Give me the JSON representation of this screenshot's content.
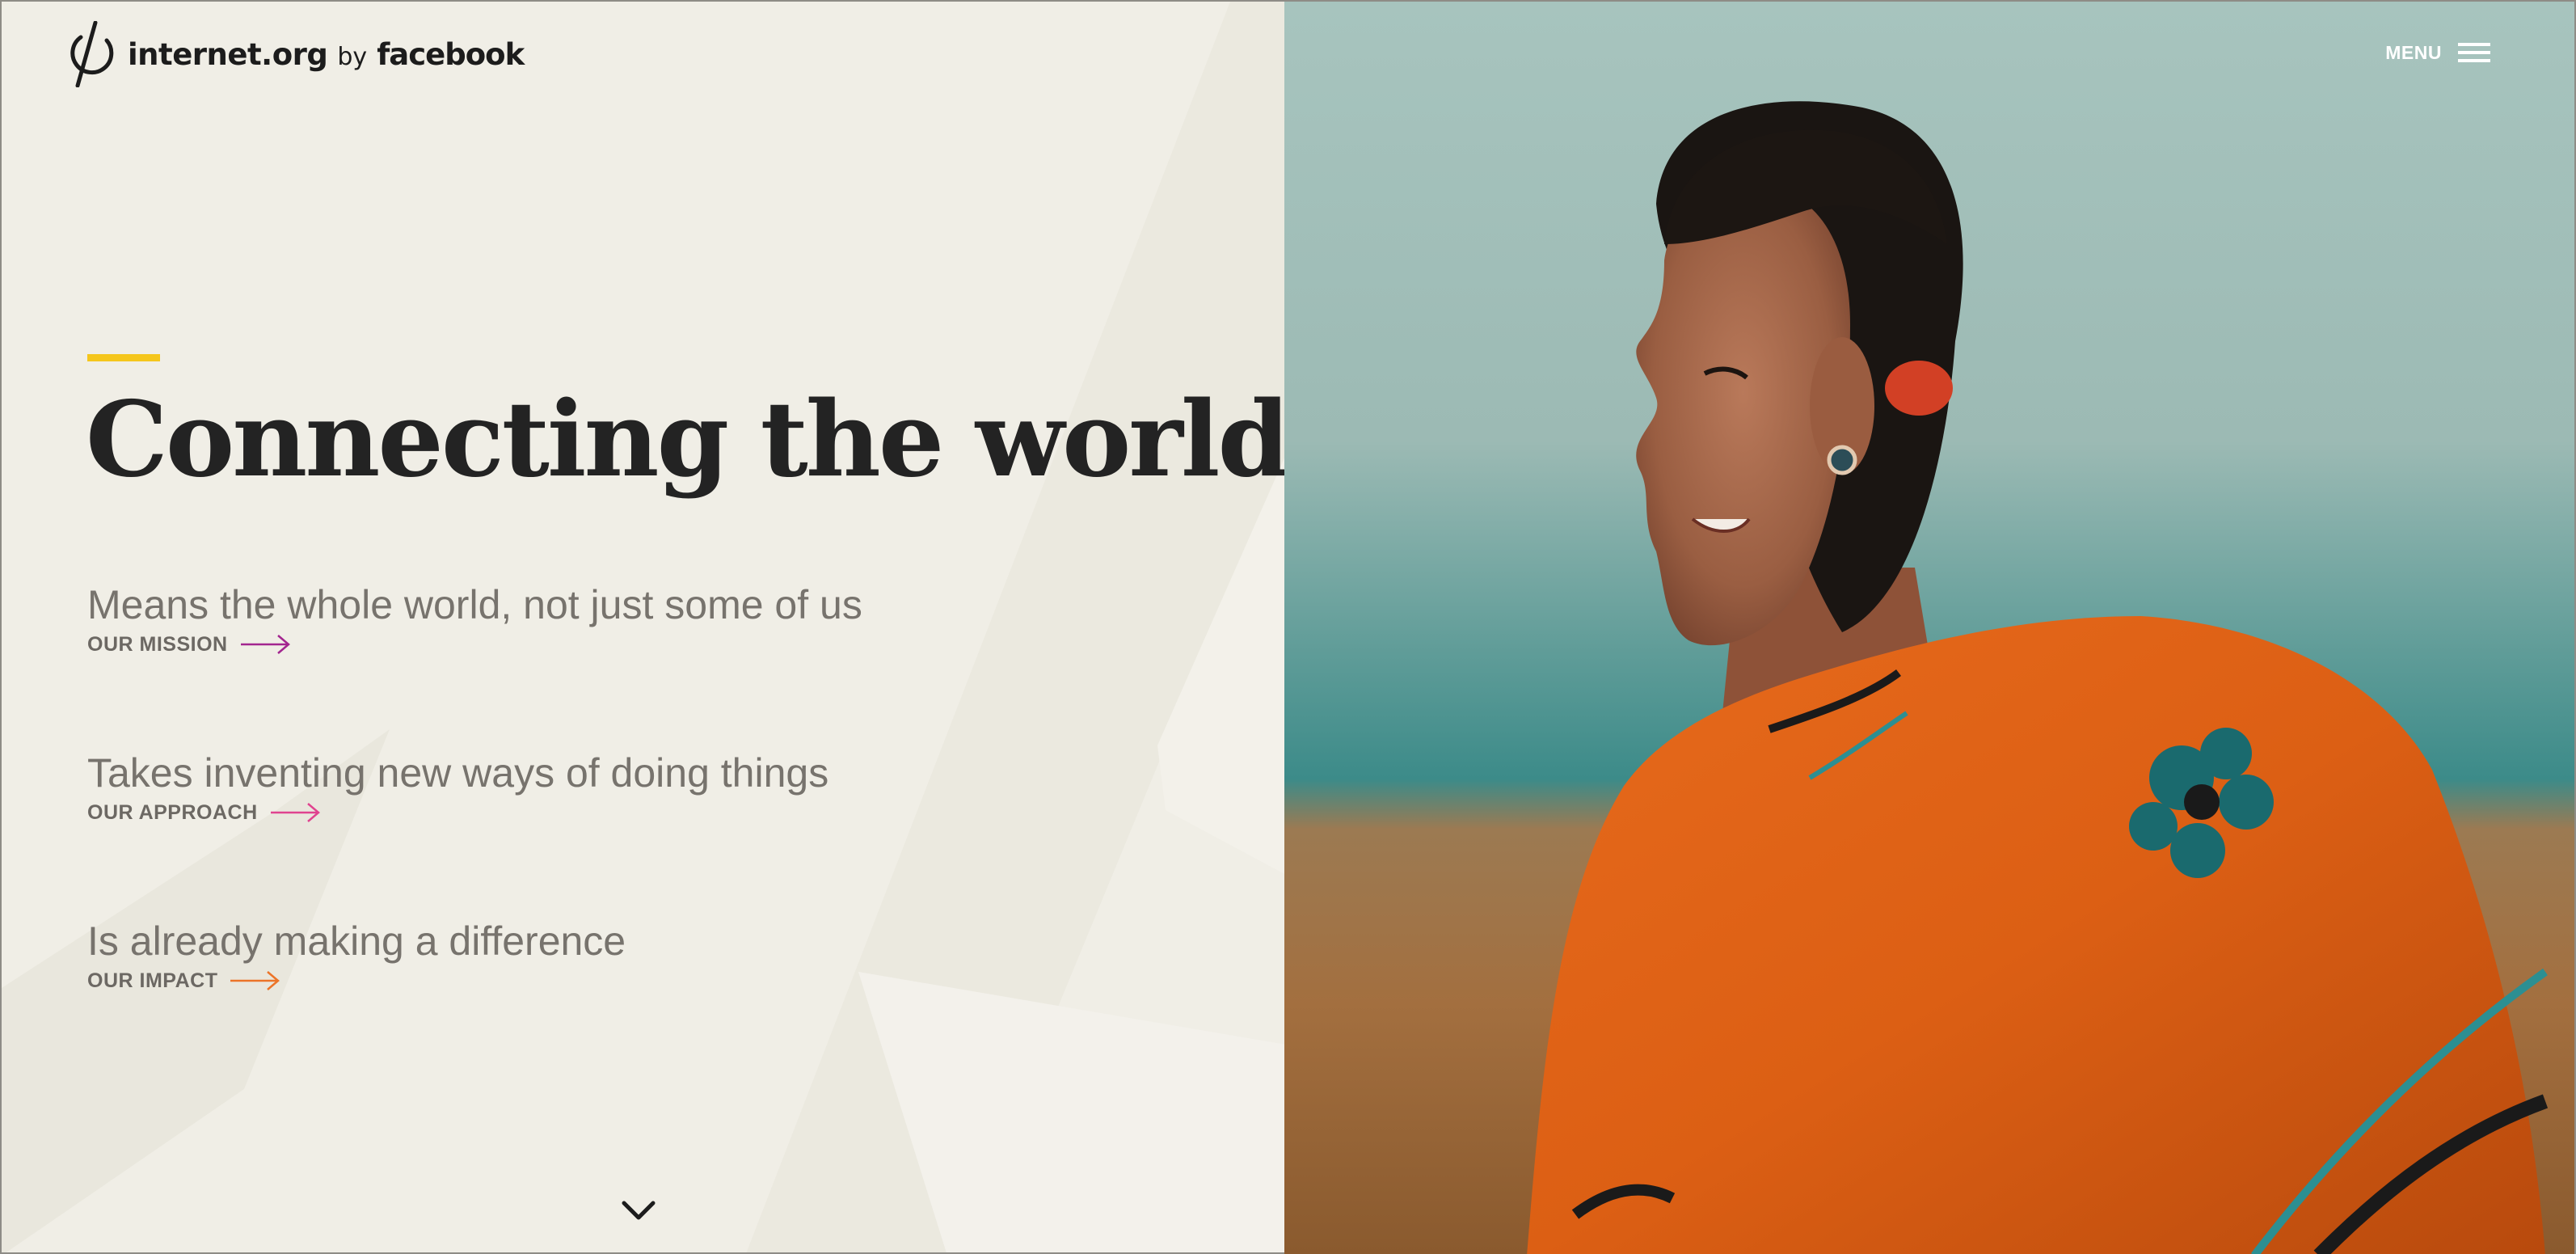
{
  "header": {
    "logo_name": "internet.org",
    "logo_by": "by",
    "logo_brand": "facebook",
    "menu_label": "MENU"
  },
  "hero": {
    "headline": "Connecting the world",
    "accent_color": "#f5c61c",
    "items": [
      {
        "text": "Means the whole world, not just some of us",
        "link_label": "OUR MISSION",
        "arrow_color": "#a3258f"
      },
      {
        "text": "Takes inventing new ways of doing things",
        "link_label": "OUR APPROACH",
        "arrow_color": "#e0438f"
      },
      {
        "text": "Is already making a difference",
        "link_label": "OUR IMPACT",
        "arrow_color": "#ec7428"
      }
    ]
  },
  "icons": {
    "logo": "internet-org-logo-icon",
    "menu": "hamburger-icon",
    "scroll": "chevron-down-icon",
    "arrow": "arrow-right-icon"
  },
  "photo": {
    "subject": "woman-in-orange-shawl-image"
  }
}
